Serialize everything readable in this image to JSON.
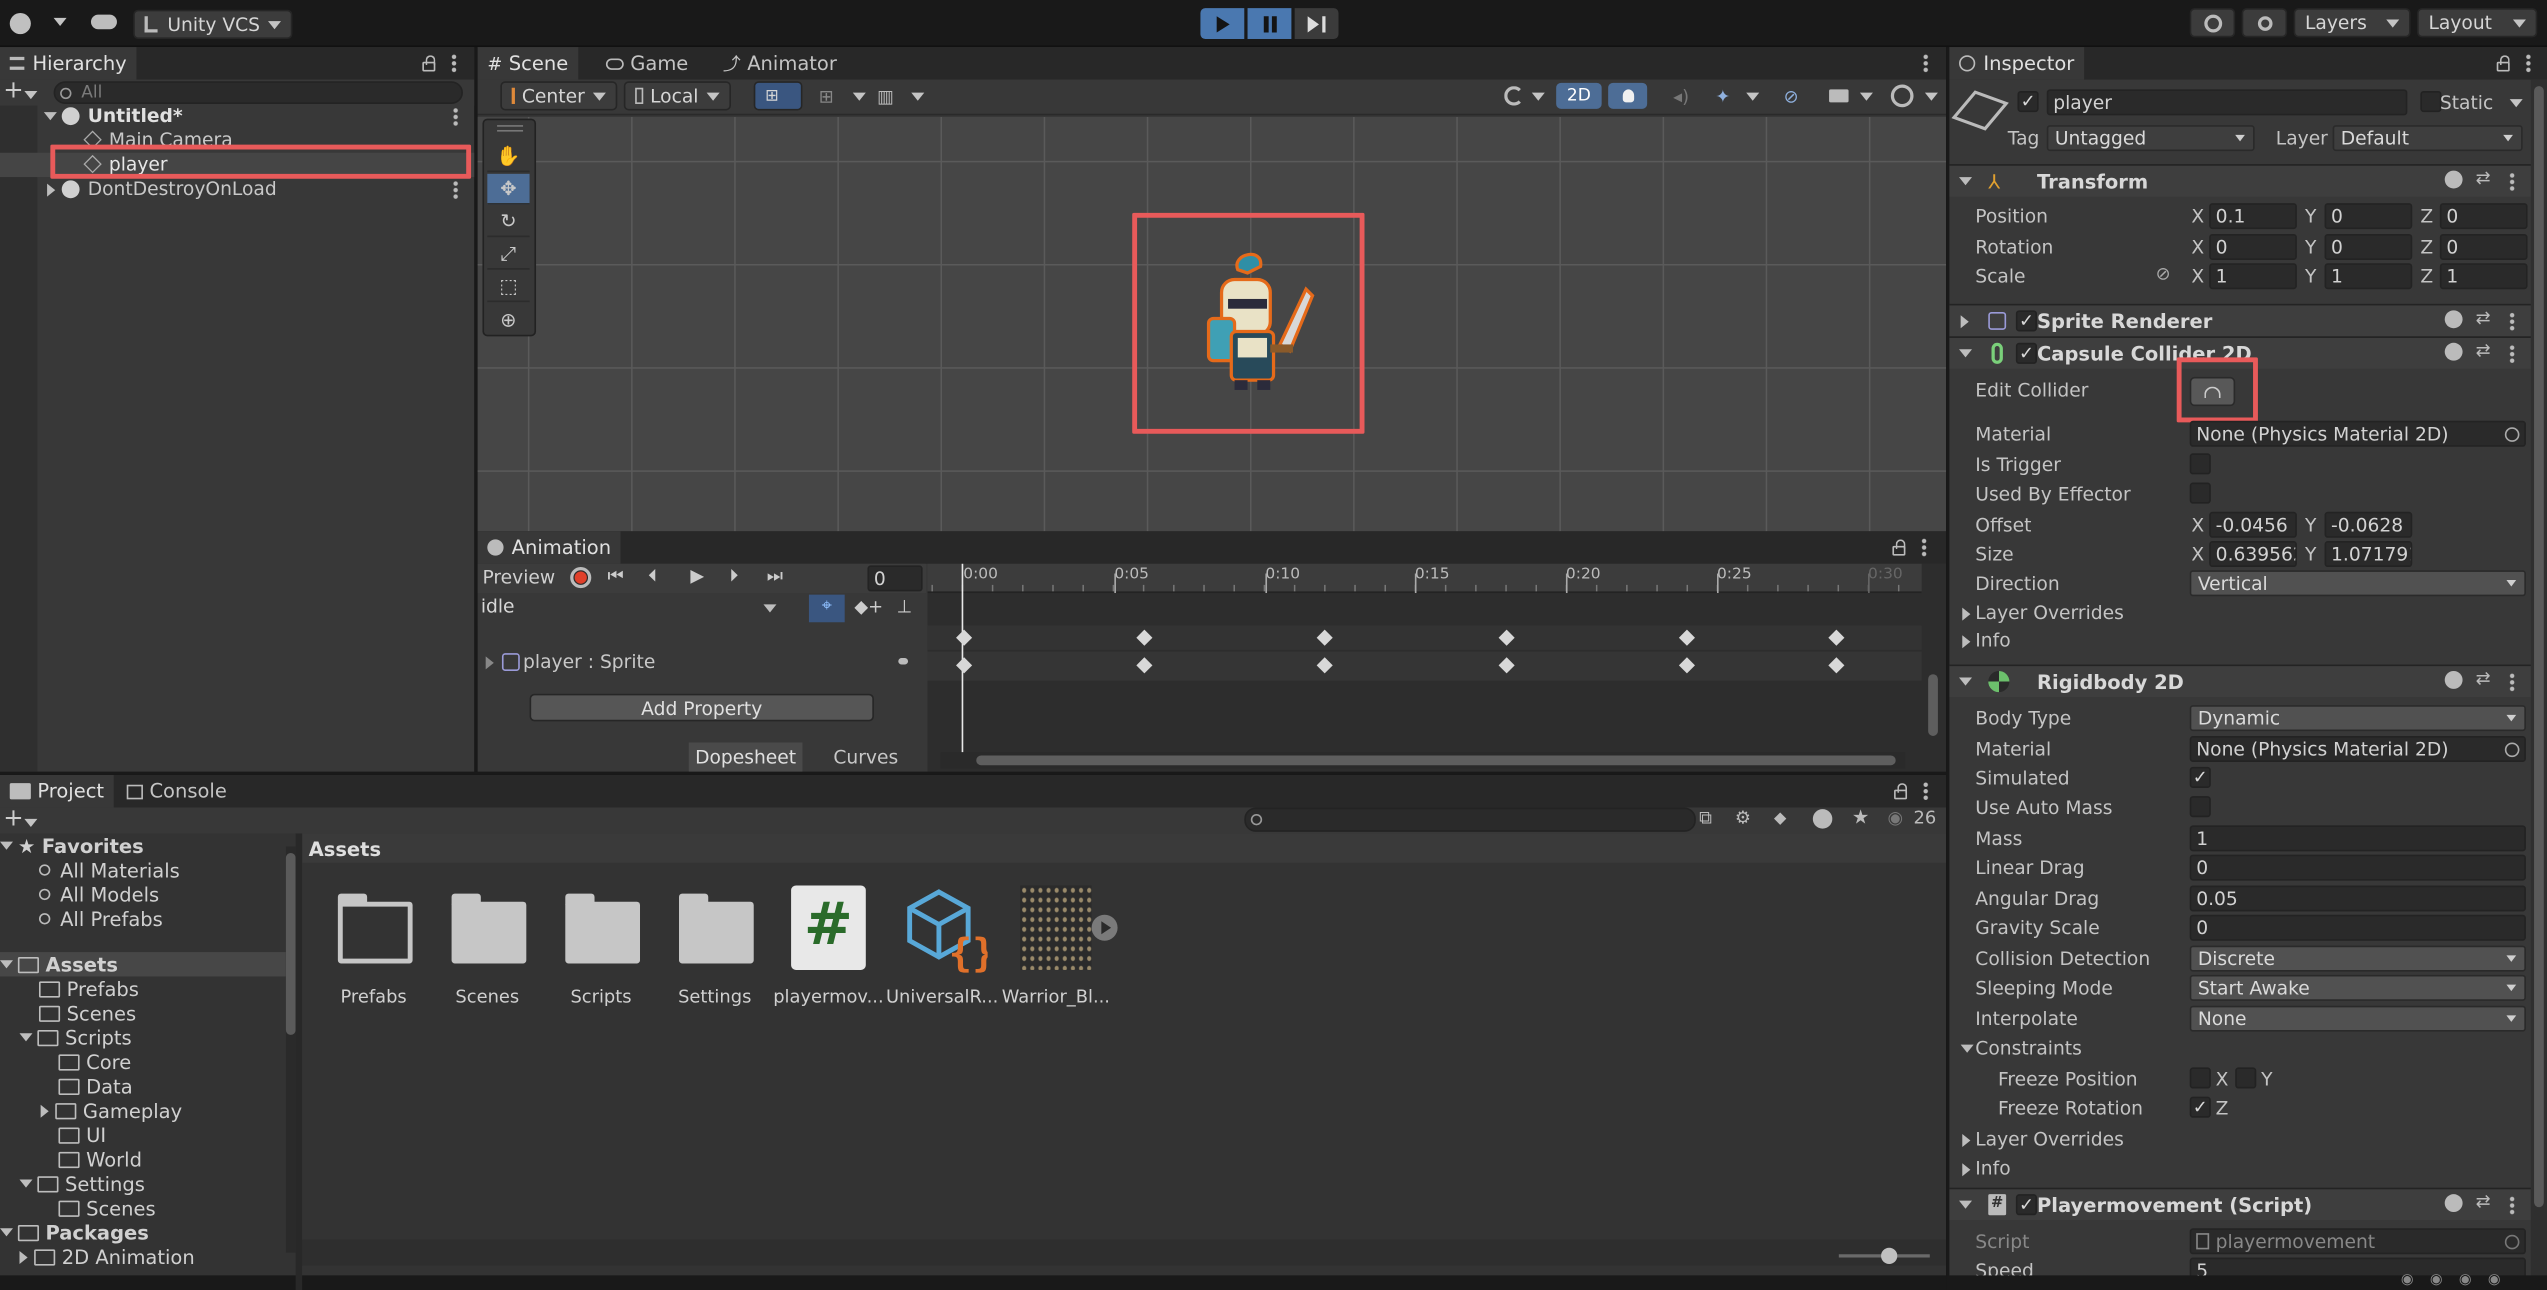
{
  "topbar": {
    "vcs_label": "Unity VCS",
    "layers_label": "Layers",
    "layout_label": "Layout"
  },
  "hierarchy": {
    "tab": "Hierarchy",
    "search_placeholder": "All",
    "scene": "Untitled*",
    "items": [
      "Main Camera",
      "player"
    ],
    "ddol": "DontDestroyOnLoad"
  },
  "scene_view": {
    "tabs": [
      "Scene",
      "Game",
      "Animator"
    ],
    "pivot": "Center",
    "space": "Local",
    "mode_2d": "2D"
  },
  "animation": {
    "tab": "Animation",
    "preview": "Preview",
    "frame": "0",
    "clip": "idle",
    "property": "player : Sprite",
    "add_property": "Add Property",
    "dopesheet": "Dopesheet",
    "curves": "Curves",
    "ruler": [
      "0:00",
      "0:05",
      "0:10",
      "0:15",
      "0:20",
      "0:25",
      "0:30"
    ]
  },
  "project": {
    "tabs": [
      "Project",
      "Console"
    ],
    "count": "26",
    "favorites": "Favorites",
    "fav_items": [
      "All Materials",
      "All Models",
      "All Prefabs"
    ],
    "assets_root": "Assets",
    "tree": [
      "Prefabs",
      "Scenes",
      "Scripts",
      "Core",
      "Data",
      "Gameplay",
      "UI",
      "World",
      "Settings",
      "Scenes"
    ],
    "packages": "Packages",
    "packages_items": [
      "2D Animation"
    ],
    "breadcrumb": "Assets",
    "assets": [
      "Prefabs",
      "Scenes",
      "Scripts",
      "Settings",
      "playermov...",
      "UniversalR...",
      "Warrior_Bl..."
    ]
  },
  "inspector": {
    "tab": "Inspector",
    "object_name": "player",
    "static_label": "Static",
    "tag_label": "Tag",
    "tag_value": "Untagged",
    "layer_label": "Layer",
    "layer_value": "Default",
    "transform": {
      "title": "Transform",
      "position_label": "Position",
      "rotation_label": "Rotation",
      "scale_label": "Scale",
      "position": [
        "0.1",
        "0",
        "0"
      ],
      "rotation": [
        "0",
        "0",
        "0"
      ],
      "scale": [
        "1",
        "1",
        "1"
      ]
    },
    "sprite_renderer": "Sprite Renderer",
    "capsule": {
      "title": "Capsule Collider 2D",
      "edit_collider": "Edit Collider",
      "material_label": "Material",
      "material": "None (Physics Material 2D)",
      "is_trigger": "Is Trigger",
      "used_by_effector": "Used By Effector",
      "offset_label": "Offset",
      "offset": [
        "-0.0456",
        "-0.0628"
      ],
      "size_label": "Size",
      "size": [
        "0.639562",
        "1.071791"
      ],
      "direction_label": "Direction",
      "direction": "Vertical",
      "layer_overrides": "Layer Overrides",
      "info": "Info"
    },
    "rigidbody": {
      "title": "Rigidbody 2D",
      "body_type_label": "Body Type",
      "body_type": "Dynamic",
      "material_label": "Material",
      "material": "None (Physics Material 2D)",
      "simulated": "Simulated",
      "use_auto_mass": "Use Auto Mass",
      "mass_label": "Mass",
      "mass": "1",
      "linear_drag_label": "Linear Drag",
      "linear_drag": "0",
      "angular_drag_label": "Angular Drag",
      "angular_drag": "0.05",
      "gravity_label": "Gravity Scale",
      "gravity": "0",
      "collision_label": "Collision Detection",
      "collision": "Discrete",
      "sleeping_label": "Sleeping Mode",
      "sleeping": "Start Awake",
      "interpolate_label": "Interpolate",
      "interpolate": "None",
      "constraints": "Constraints",
      "freeze_position": "Freeze Position",
      "freeze_rotation": "Freeze Rotation",
      "layer_overrides": "Layer Overrides",
      "info": "Info"
    },
    "script": {
      "title": "Playermovement (Script)",
      "script_label": "Script",
      "script_value": "playermovement",
      "speed_label": "Speed",
      "speed": "5"
    }
  }
}
